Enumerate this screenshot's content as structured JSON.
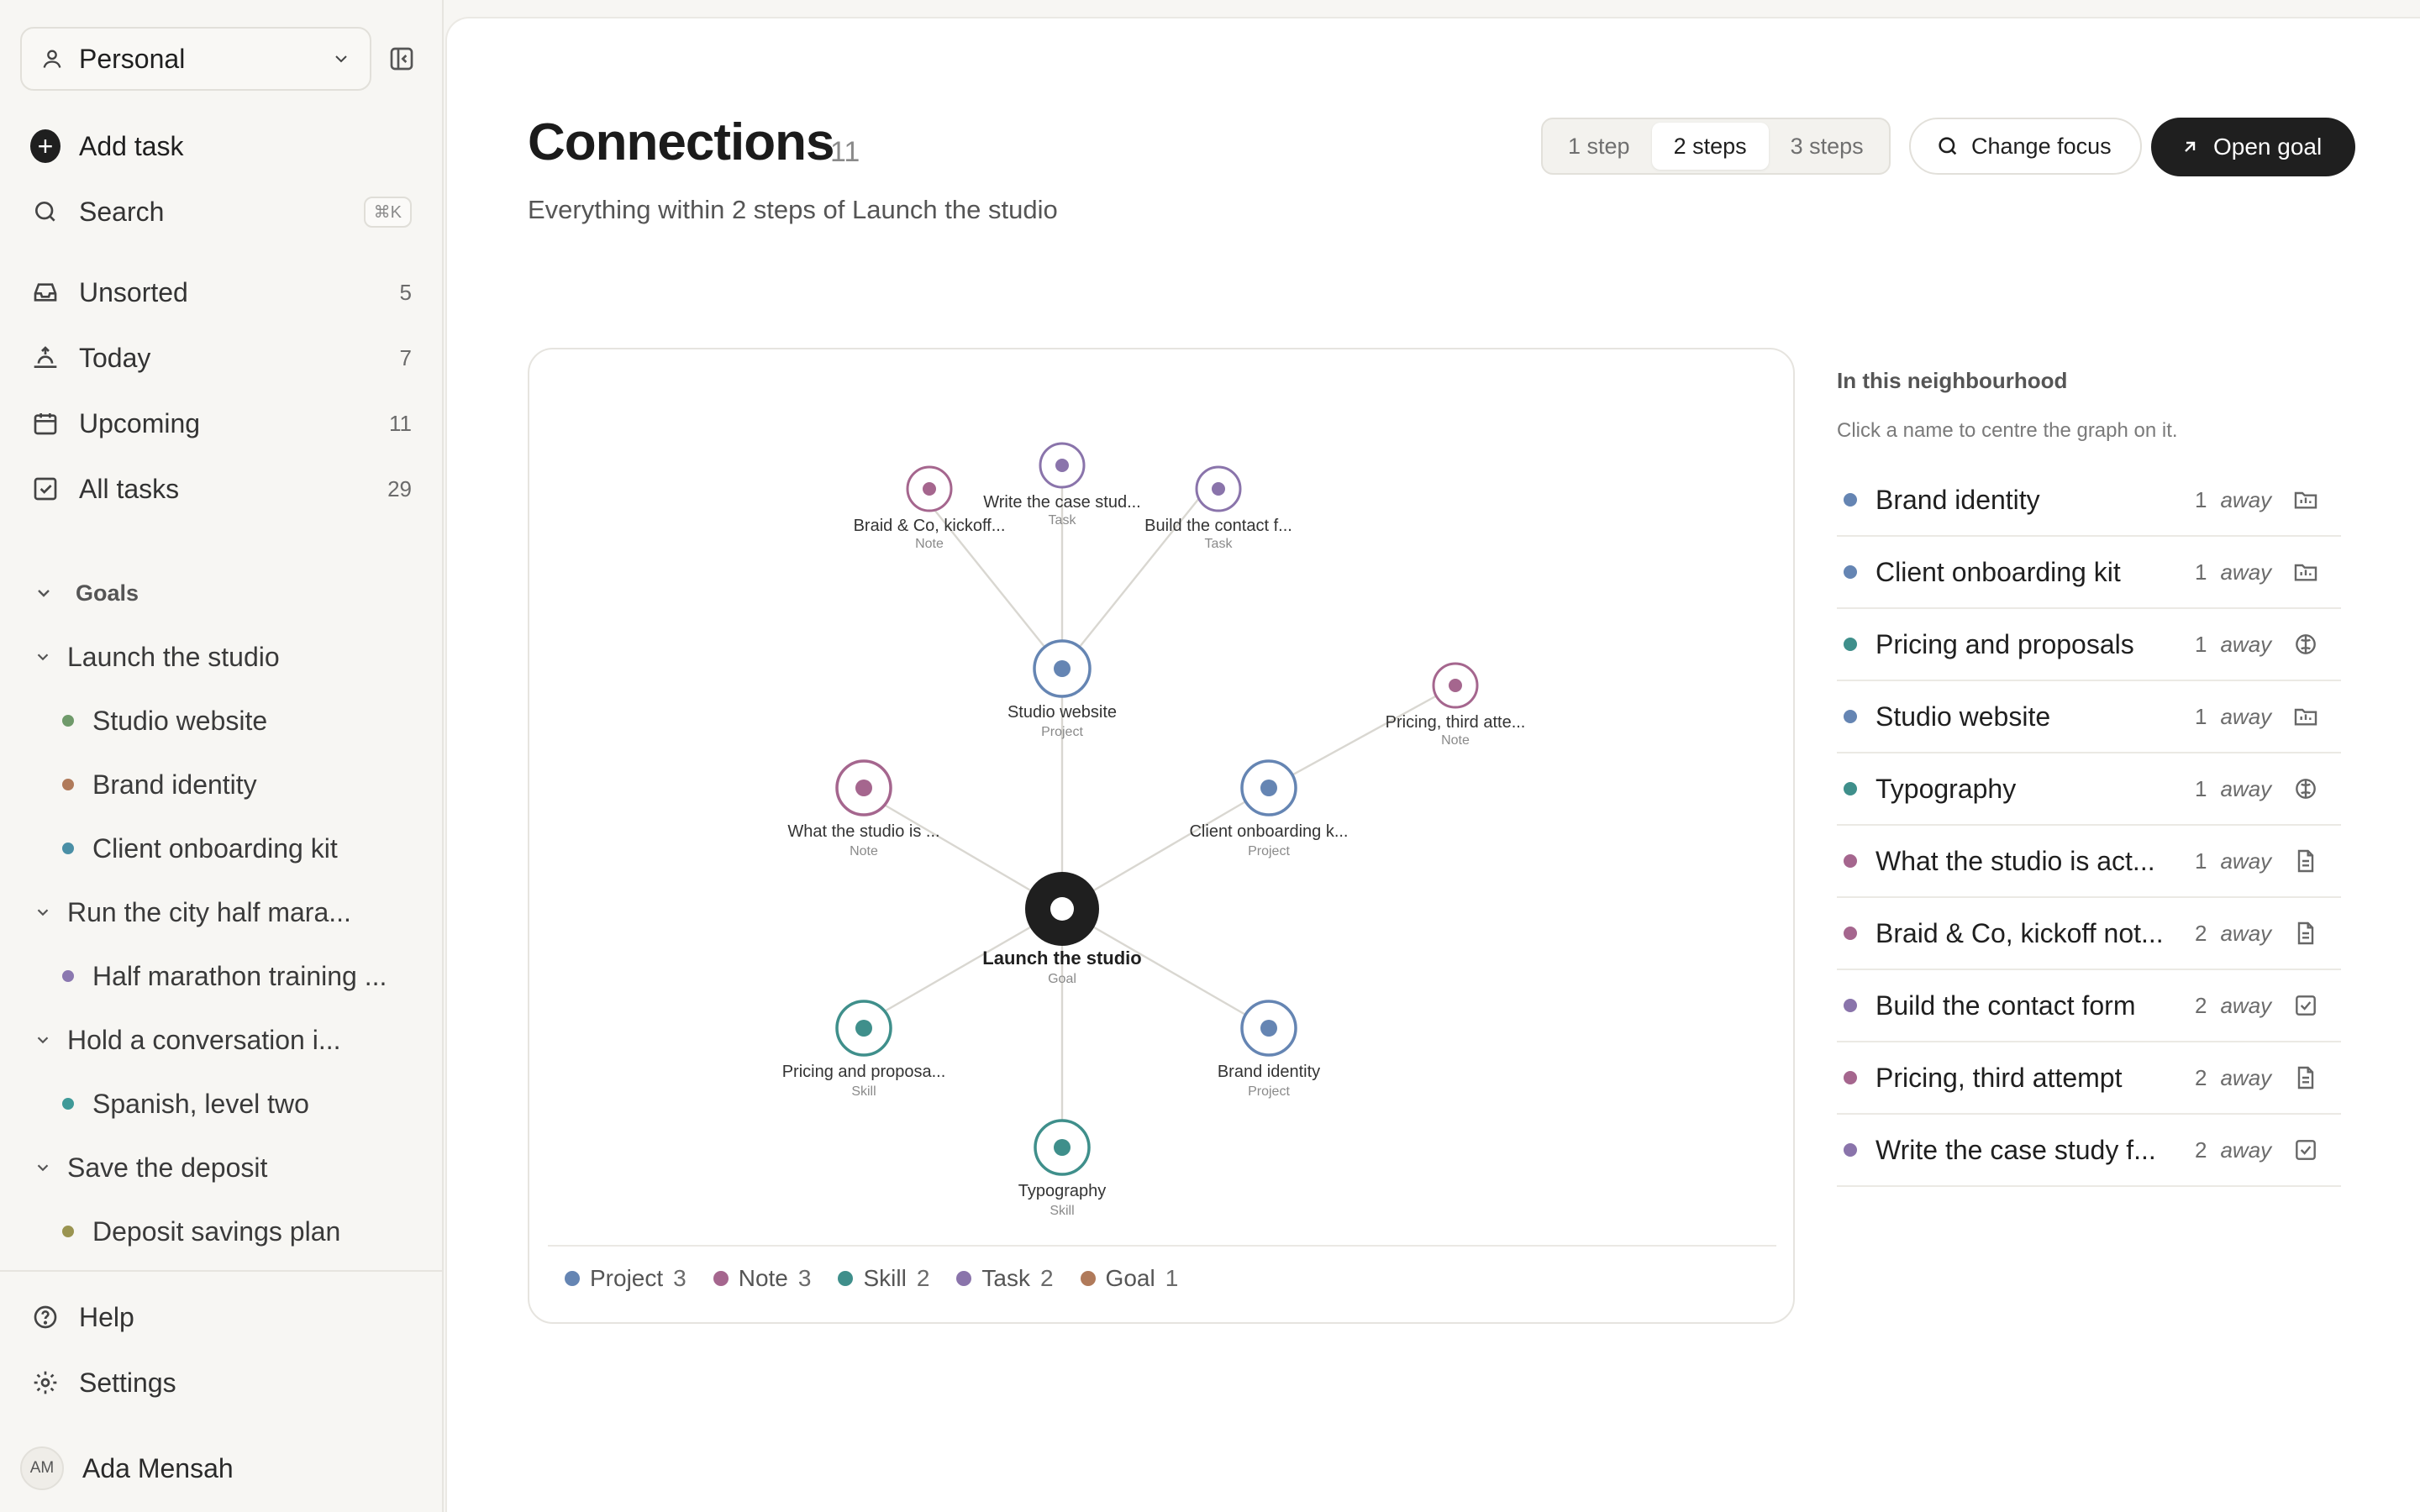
{
  "sidebar": {
    "workspace": "Personal",
    "add_task": "Add task",
    "search": "Search",
    "search_shortcut": "⌘K",
    "nav": [
      {
        "label": "Unsorted",
        "count": "5"
      },
      {
        "label": "Today",
        "count": "7"
      },
      {
        "label": "Upcoming",
        "count": "11"
      },
      {
        "label": "All tasks",
        "count": "29"
      }
    ],
    "goals_heading": "Goals",
    "goals": [
      {
        "label": "Launch the studio",
        "children": [
          {
            "label": "Studio website",
            "color": "#6f9a6a"
          },
          {
            "label": "Brand identity",
            "color": "#b07a5a"
          },
          {
            "label": "Client onboarding kit",
            "color": "#4a8fa6"
          }
        ]
      },
      {
        "label": "Run the city half mara...",
        "children": [
          {
            "label": "Half marathon training ...",
            "color": "#8b78b0"
          }
        ]
      },
      {
        "label": "Hold a conversation i...",
        "children": [
          {
            "label": "Spanish, level two",
            "color": "#3f9a98"
          }
        ]
      },
      {
        "label": "Save the deposit",
        "children": [
          {
            "label": "Deposit savings plan",
            "color": "#9a9450"
          }
        ]
      }
    ],
    "help": "Help",
    "settings": "Settings",
    "user_initials": "AM",
    "user_name": "Ada Mensah"
  },
  "header": {
    "title": "Connections",
    "count": "11",
    "subtitle": "Everything within 2 steps of Launch the studio",
    "steps": [
      "1 step",
      "2 steps",
      "3 steps"
    ],
    "active_step": "2 steps",
    "change_focus": "Change focus",
    "open_goal": "Open goal"
  },
  "colors": {
    "project": "#6585b3",
    "note": "#a5668e",
    "skill": "#3f8f8b",
    "task": "#8a74ab",
    "goal": "#b07a5a",
    "center": "#1f1f1f"
  },
  "graph": {
    "nodes": [
      {
        "id": "center",
        "label": "Launch the studio",
        "type": "Goal"
      },
      {
        "id": "studio-website",
        "label": "Studio website",
        "type": "Project"
      },
      {
        "id": "what-studio",
        "label": "What the studio is ...",
        "type": "Note"
      },
      {
        "id": "client-onboarding",
        "label": "Client onboarding k...",
        "type": "Project"
      },
      {
        "id": "pricing-proposals",
        "label": "Pricing and proposa...",
        "type": "Skill"
      },
      {
        "id": "brand-identity",
        "label": "Brand identity",
        "type": "Project"
      },
      {
        "id": "typography",
        "label": "Typography",
        "type": "Skill"
      },
      {
        "id": "braid",
        "label": "Braid & Co, kickoff...",
        "type": "Note"
      },
      {
        "id": "case-study",
        "label": "Write the case stud...",
        "type": "Task"
      },
      {
        "id": "contact-form",
        "label": "Build the contact f...",
        "type": "Task"
      },
      {
        "id": "pricing-third",
        "label": "Pricing, third atte...",
        "type": "Note"
      }
    ],
    "legend": [
      {
        "label": "Project",
        "count": "3",
        "key": "project"
      },
      {
        "label": "Note",
        "count": "3",
        "key": "note"
      },
      {
        "label": "Skill",
        "count": "2",
        "key": "skill"
      },
      {
        "label": "Task",
        "count": "2",
        "key": "task"
      },
      {
        "label": "Goal",
        "count": "1",
        "key": "goal"
      }
    ]
  },
  "neighbourhood": {
    "title": "In this neighbourhood",
    "hint": "Click a name to centre the graph on it.",
    "away_word": "away",
    "items": [
      {
        "name": "Brand identity",
        "distance": "1",
        "icon": "project-icon",
        "color": "#6585b3"
      },
      {
        "name": "Client onboarding kit",
        "distance": "1",
        "icon": "project-icon",
        "color": "#6585b3"
      },
      {
        "name": "Pricing and proposals",
        "distance": "1",
        "icon": "skill-icon",
        "color": "#3f8f8b"
      },
      {
        "name": "Studio website",
        "distance": "1",
        "icon": "project-icon",
        "color": "#6585b3"
      },
      {
        "name": "Typography",
        "distance": "1",
        "icon": "skill-icon",
        "color": "#3f8f8b"
      },
      {
        "name": "What the studio is act...",
        "distance": "1",
        "icon": "note-icon",
        "color": "#a5668e"
      },
      {
        "name": "Braid & Co, kickoff not...",
        "distance": "2",
        "icon": "note-icon",
        "color": "#a5668e"
      },
      {
        "name": "Build the contact form",
        "distance": "2",
        "icon": "task-icon",
        "color": "#8a74ab"
      },
      {
        "name": "Pricing, third attempt",
        "distance": "2",
        "icon": "note-icon",
        "color": "#a5668e"
      },
      {
        "name": "Write the case study f...",
        "distance": "2",
        "icon": "task-icon",
        "color": "#8a74ab"
      }
    ]
  }
}
